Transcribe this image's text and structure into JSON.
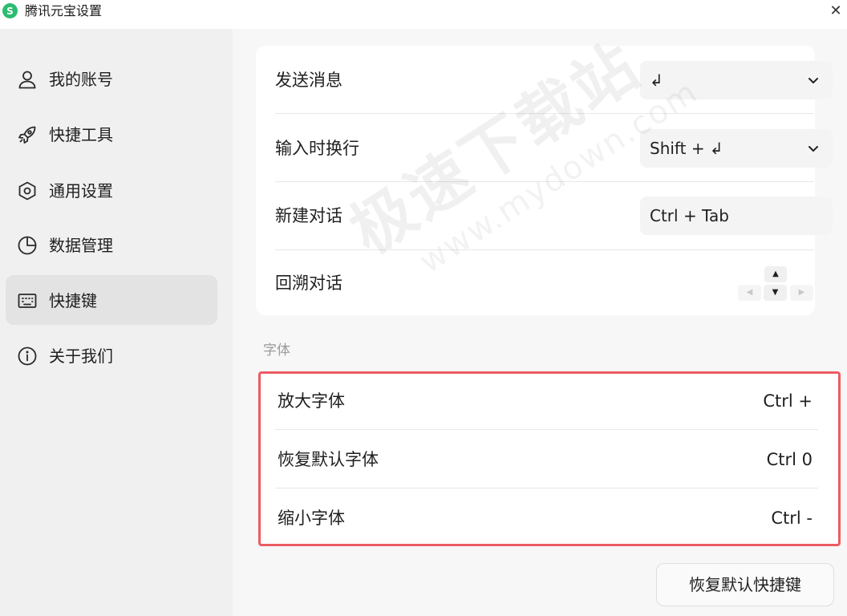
{
  "window": {
    "title": "腾讯元宝设置",
    "logo_glyph": "S",
    "close_glyph": "✕"
  },
  "sidebar": {
    "items": [
      {
        "label": "我的账号",
        "icon": "user-icon"
      },
      {
        "label": "快捷工具",
        "icon": "rocket-icon"
      },
      {
        "label": "通用设置",
        "icon": "hexagon-settings-icon"
      },
      {
        "label": "数据管理",
        "icon": "pie-chart-icon"
      },
      {
        "label": "快捷键",
        "icon": "keyboard-icon",
        "active": true
      },
      {
        "label": "关于我们",
        "icon": "info-icon"
      }
    ]
  },
  "main": {
    "shortcuts": [
      {
        "label": "发送消息",
        "value": "↲",
        "type": "select"
      },
      {
        "label": "输入时换行",
        "value": "Shift + ↲",
        "type": "select"
      },
      {
        "label": "新建对话",
        "value": "Ctrl + Tab",
        "type": "input"
      },
      {
        "label": "回溯对话",
        "type": "arrows",
        "arrows": {
          "up": "▲",
          "down": "▼",
          "left": "◀",
          "right": "▶"
        }
      }
    ],
    "font_section": {
      "title": "字体",
      "rows": [
        {
          "label": "放大字体",
          "value": "Ctrl +"
        },
        {
          "label": "恢复默认字体",
          "value": "Ctrl 0"
        },
        {
          "label": "缩小字体",
          "value": "Ctrl -"
        }
      ]
    },
    "reset_button": "恢复默认快捷键"
  },
  "watermark": {
    "cn": "极速下载站",
    "en": "www.mydown.com"
  },
  "colors": {
    "highlight_border": "#ed5b62",
    "logo_green": "#2bbd6f",
    "active_nav": "#e3e3e3"
  }
}
